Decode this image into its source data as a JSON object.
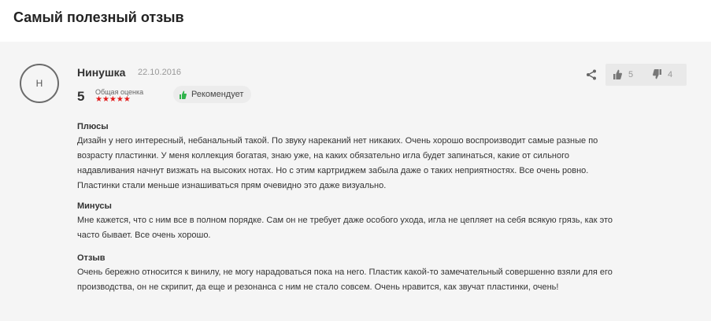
{
  "section": {
    "title": "Самый полезный отзыв"
  },
  "review": {
    "avatar_letter": "Н",
    "author": "Нинушка",
    "date": "22.10.2016",
    "score": "5",
    "score_label": "Общая оценка",
    "stars": "★★★★★",
    "rating": 5,
    "recommend_label": "Рекомендует",
    "votes": {
      "up": "5",
      "down": "4"
    },
    "pros_title": "Плюсы",
    "pros_text": "Дизайн у него интересный, небанальный такой. По звуку нареканий нет никаких. Очень хорошо воспроизводит самые разные по возрасту пластинки. У меня коллекция богатая, знаю уже, на каких обязательно игла будет запинаться, какие от сильного надавливания начнут визжать на высоких нотах. Но с этим картриджем забыла даже о таких неприятностях. Все очень ровно. Пластинки стали меньше изнашиваться прям очевидно это даже визуально.",
    "cons_title": "Минусы",
    "cons_text": "Мне кажется, что с ним все в полном порядке. Сам он не требует даже особого ухода, игла не цепляет на себя всякую грязь, как это часто бывает. Все очень хорошо.",
    "comment_title": "Отзыв",
    "comment_text": "Очень бережно относится к винилу, не могу нарадоваться пока на него. Пластик какой-то замечательный совершенно взяли для его производства, он не скрипит, да еще и резонанса с ним не стало совсем. Очень нравится, как звучат пластинки, очень!"
  },
  "colors": {
    "star": "#e21a1a",
    "recommend_icon": "#2fb34a",
    "card_bg": "#f5f5f5"
  },
  "icons": {
    "share": "share-icon",
    "thumb_up": "thumb-up-icon",
    "thumb_down": "thumb-down-icon",
    "recommend": "thumb-up-icon"
  }
}
